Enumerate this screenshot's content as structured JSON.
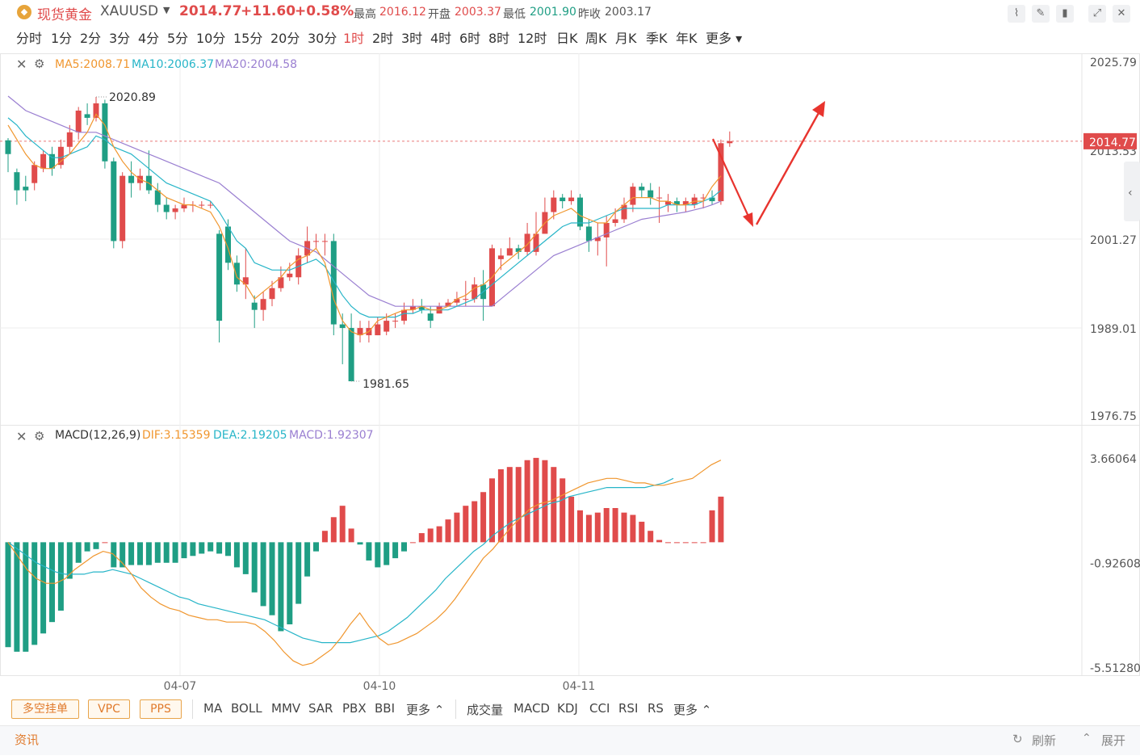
{
  "header": {
    "symbol_name": "现货黄金",
    "symbol_code": "XAUUSD",
    "price": "2014.77",
    "change": "+11.60",
    "change_pct": "+0.58%",
    "high_label": "最高",
    "high": "2016.12",
    "open_label": "开盘",
    "open": "2003.37",
    "low_label": "最低",
    "low": "2001.90",
    "prev_close_label": "昨收",
    "prev_close": "2003.17"
  },
  "periods": [
    "分时",
    "1分",
    "2分",
    "3分",
    "4分",
    "5分",
    "10分",
    "15分",
    "20分",
    "30分",
    "1时",
    "2时",
    "3时",
    "4时",
    "6时",
    "8时",
    "12时",
    "日K",
    "周K",
    "月K",
    "季K",
    "年K",
    "更多"
  ],
  "active_period": "1时",
  "ma_legend": {
    "ma5": "MA5:2008.71",
    "ma10": "MA10:2006.37",
    "ma20": "MA20:2004.58"
  },
  "macd_legend": {
    "name": "MACD(12,26,9)",
    "dif": "DIF:3.15359",
    "dea": "DEA:2.19205",
    "macd": "MACD:1.92307"
  },
  "price_axis": [
    "2025.79",
    "2013.53",
    "2001.27",
    "1989.01",
    "1976.75"
  ],
  "current_price_tag": "2014.77",
  "macd_axis": [
    "3.66064",
    "-0.92608",
    "-5.51280"
  ],
  "high_marker": "2020.89",
  "low_marker": "1981.65",
  "date_labels": [
    "04-07",
    "04-10",
    "04-11"
  ],
  "bottom_buttons": [
    "多空挂单",
    "VPC",
    "PPS"
  ],
  "main_indicators": [
    "MA",
    "BOLL",
    "MMV",
    "SAR",
    "PBX",
    "BBI",
    "更多"
  ],
  "sub_indicators": [
    "成交量",
    "MACD",
    "KDJ",
    "CCI",
    "RSI",
    "RS",
    "更多"
  ],
  "footer": {
    "news": "资讯",
    "refresh": "刷新",
    "expand": "展开"
  },
  "colors": {
    "up": "#e04b4b",
    "down": "#1f9e84",
    "ma5": "#f0962e",
    "ma10": "#27b5c8",
    "ma20": "#9a7fd1",
    "accent": "#e07a2c"
  },
  "chart_data": {
    "type": "candlestick",
    "x_ticks": [
      "04-07",
      "04-10",
      "04-11"
    ],
    "ylim": [
      1976.75,
      2025.79
    ],
    "candles": [
      [
        2014.9,
        2013.0,
        2015.2,
        2010.5
      ],
      [
        2010.5,
        2008.0,
        2011.0,
        2006.0
      ],
      [
        2008.5,
        2008.0,
        2010.0,
        2006.5
      ],
      [
        2009.0,
        2011.5,
        2012.0,
        2008.0
      ],
      [
        2011.0,
        2013.0,
        2013.5,
        2010.5
      ],
      [
        2013.0,
        2011.0,
        2014.0,
        2010.0
      ],
      [
        2011.5,
        2014.0,
        2015.0,
        2011.0
      ],
      [
        2014.0,
        2016.0,
        2017.0,
        2013.0
      ],
      [
        2016.0,
        2019.0,
        2019.5,
        2015.0
      ],
      [
        2018.5,
        2018.0,
        2020.0,
        2017.0
      ],
      [
        2018.0,
        2020.0,
        2020.89,
        2017.5
      ],
      [
        2020.0,
        2012.0,
        2020.5,
        2011.0
      ],
      [
        2012.0,
        2001.0,
        2012.5,
        2000.0
      ],
      [
        2001.0,
        2010.0,
        2010.5,
        2000.0
      ],
      [
        2010.0,
        2009.0,
        2012.0,
        2007.0
      ],
      [
        2009.0,
        2010.0,
        2011.0,
        2008.0
      ],
      [
        2010.0,
        2008.0,
        2013.5,
        2007.5
      ],
      [
        2008.0,
        2006.0,
        2009.0,
        2005.0
      ],
      [
        2006.0,
        2005.0,
        2007.0,
        2004.0
      ],
      [
        2005.0,
        2005.5,
        2006.0,
        2004.0
      ],
      [
        2005.5,
        2006.0,
        2007.0,
        2005.0
      ],
      [
        2006.0,
        2006.0,
        2006.5,
        2005.0
      ],
      [
        2006.0,
        2006.0,
        2006.5,
        2005.5
      ],
      [
        2006.0,
        2006.0,
        2006.5,
        2005.5
      ],
      [
        2002.0,
        1990.0,
        2002.5,
        1987.0
      ],
      [
        2003.0,
        1998.0,
        2004.0,
        1997.0
      ],
      [
        1998.0,
        1995.0,
        1999.0,
        1994.0
      ],
      [
        1995.0,
        1996.0,
        2000.0,
        1993.0
      ],
      [
        1992.5,
        1991.5,
        1993.5,
        1989.0
      ],
      [
        1991.5,
        1993.0,
        1994.0,
        1990.0
      ],
      [
        1993.0,
        1994.5,
        1995.5,
        1992.0
      ],
      [
        1994.5,
        1996.0,
        1997.5,
        1994.0
      ],
      [
        1996.0,
        1996.5,
        1998.0,
        1995.5
      ],
      [
        1996.0,
        1999.0,
        2000.0,
        1995.0
      ],
      [
        1999.0,
        2001.0,
        2003.0,
        1998.0
      ],
      [
        2001.0,
        2001.0,
        2002.0,
        2000.0
      ],
      [
        2001.0,
        2001.0,
        2002.0,
        1999.0
      ],
      [
        2001.0,
        1989.5,
        2002.0,
        1988.0
      ],
      [
        1989.5,
        1989.0,
        1991.0,
        1984.0
      ],
      [
        1989.0,
        1981.65,
        1991.0,
        1981.65
      ],
      [
        1988.0,
        1989.0,
        1990.0,
        1987.0
      ],
      [
        1988.0,
        1989.0,
        1990.0,
        1987.0
      ],
      [
        1988.0,
        1989.5,
        1990.5,
        1988.0
      ],
      [
        1988.5,
        1990.0,
        1991.0,
        1988.0
      ],
      [
        1990.0,
        1990.0,
        1991.0,
        1989.0
      ],
      [
        1990.0,
        1991.5,
        1992.5,
        1989.5
      ],
      [
        1991.5,
        1992.0,
        1993.0,
        1991.0
      ],
      [
        1992.0,
        1991.5,
        1993.0,
        1991.0
      ],
      [
        1991.0,
        1990.0,
        1992.0,
        1989.0
      ],
      [
        1991.0,
        1992.0,
        1992.5,
        1991.0
      ],
      [
        1992.0,
        1992.5,
        1993.0,
        1992.0
      ],
      [
        1992.5,
        1993.0,
        1994.0,
        1992.0
      ],
      [
        1993.0,
        1993.0,
        1995.5,
        1992.0
      ],
      [
        1993.0,
        1995.0,
        1996.0,
        1992.5
      ],
      [
        1995.0,
        1993.0,
        1997.0,
        1990.0
      ],
      [
        1992.0,
        2000.0,
        2000.5,
        1992.0
      ],
      [
        1998.5,
        1999.0,
        2000.0,
        1997.0
      ],
      [
        1999.0,
        2000.0,
        2001.5,
        1999.0
      ],
      [
        2000.0,
        1999.5,
        2000.5,
        1998.5
      ],
      [
        1999.5,
        2002.0,
        2003.5,
        1999.0
      ],
      [
        1999.5,
        2002.0,
        2005.0,
        1999.0
      ],
      [
        2002.0,
        2005.0,
        2007.0,
        2002.0
      ],
      [
        2005.0,
        2007.0,
        2008.0,
        2004.0
      ],
      [
        2007.0,
        2006.5,
        2007.5,
        2005.5
      ],
      [
        2006.5,
        2007.0,
        2008.0,
        2006.0
      ],
      [
        2007.0,
        2003.0,
        2007.5,
        2002.5
      ],
      [
        2003.0,
        2001.0,
        2004.0,
        1999.5
      ],
      [
        2001.0,
        2001.5,
        2003.5,
        1999.0
      ],
      [
        2001.5,
        2003.5,
        2004.5,
        1997.5
      ],
      [
        2003.5,
        2004.0,
        2005.5,
        2003.0
      ],
      [
        2004.0,
        2006.0,
        2007.0,
        2003.5
      ],
      [
        2006.0,
        2008.5,
        2009.0,
        2005.0
      ],
      [
        2008.5,
        2008.0,
        2009.0,
        2007.0
      ],
      [
        2008.0,
        2007.0,
        2009.0,
        2006.0
      ],
      [
        2007.0,
        2007.0,
        2008.5,
        2003.5
      ],
      [
        2006.0,
        2006.5,
        2007.5,
        2005.0
      ],
      [
        2006.5,
        2006.0,
        2007.0,
        2005.0
      ],
      [
        2006.0,
        2006.5,
        2007.0,
        2005.0
      ],
      [
        2006.0,
        2007.0,
        2007.5,
        2005.5
      ],
      [
        2007.0,
        2007.0,
        2007.5,
        2005.5
      ],
      [
        2007.0,
        2006.5,
        2008.0,
        2006.0
      ],
      [
        2006.5,
        2014.5,
        2015.0,
        2006.0
      ],
      [
        2014.5,
        2014.77,
        2016.12,
        2014.0
      ]
    ],
    "ma5": [
      2017.0,
      2015.0,
      2013.0,
      2011.5,
      2011.0,
      2011.0,
      2012.0,
      2013.0,
      2014.5,
      2016.0,
      2018.5,
      2017.0,
      2014.0,
      2012.0,
      2010.5,
      2009.5,
      2009.0,
      2008.0,
      2007.0,
      2006.5,
      2006.0,
      2006.0,
      2005.5,
      2005.0,
      2003.0,
      2000.0,
      1996.0,
      1995.0,
      1993.0,
      1994.0,
      1995.0,
      1996.0,
      1997.5,
      1998.5,
      1999.0,
      2000.0,
      1998.0,
      1993.0,
      1990.0,
      1988.5,
      1988.0,
      1988.5,
      1990.0,
      1990.5,
      1991.0,
      1991.5,
      1991.5,
      1992.0,
      1991.5,
      1991.5,
      1992.0,
      1993.0,
      1993.5,
      1994.5,
      1995.0,
      1996.0,
      1997.5,
      1998.5,
      1999.5,
      2000.5,
      2002.0,
      2003.5,
      2004.5,
      2005.0,
      2005.5,
      2004.5,
      2004.0,
      2003.5,
      2003.5,
      2005.0,
      2006.0,
      2007.0,
      2007.0,
      2007.0,
      2006.5,
      2006.5,
      2006.0,
      2006.0,
      2006.5,
      2006.5,
      2008.5,
      2010.0
    ],
    "ma10": [
      2018.0,
      2017.0,
      2015.5,
      2014.5,
      2013.5,
      2012.5,
      2012.5,
      2013.0,
      2013.5,
      2014.0,
      2015.5,
      2015.0,
      2014.0,
      2013.5,
      2013.0,
      2012.0,
      2011.0,
      2010.0,
      2009.0,
      2008.5,
      2008.0,
      2007.5,
      2007.0,
      2006.5,
      2005.0,
      2003.0,
      2001.0,
      2000.0,
      1998.0,
      1997.5,
      1997.0,
      1997.0,
      1997.0,
      1997.5,
      1998.0,
      1998.5,
      1997.5,
      1995.5,
      1993.5,
      1992.0,
      1991.0,
      1990.5,
      1990.5,
      1990.5,
      1990.5,
      1991.0,
      1991.0,
      1991.5,
      1991.5,
      1991.5,
      1991.5,
      1992.0,
      1992.5,
      1993.0,
      1994.0,
      1995.0,
      1996.0,
      1997.0,
      1998.0,
      1999.0,
      2000.0,
      2001.0,
      2002.0,
      2003.0,
      2003.5,
      2003.5,
      2003.5,
      2004.0,
      2004.5,
      2005.0,
      2005.5,
      2005.5,
      2005.5,
      2005.5,
      2005.5,
      2006.0,
      2006.0,
      2006.0,
      2006.0,
      2006.5,
      2007.0,
      2008.0
    ],
    "ma20": [
      2021.0,
      2020.0,
      2019.0,
      2018.5,
      2018.0,
      2017.5,
      2017.0,
      2016.5,
      2016.0,
      2016.0,
      2016.0,
      2015.5,
      2015.0,
      2014.5,
      2014.0,
      2013.5,
      2013.0,
      2012.5,
      2012.0,
      2011.5,
      2011.0,
      2010.5,
      2010.0,
      2009.5,
      2009.0,
      2008.0,
      2007.0,
      2006.0,
      2005.0,
      2004.0,
      2003.0,
      2002.0,
      2001.0,
      2000.5,
      2000.0,
      1999.5,
      1998.5,
      1997.5,
      1996.5,
      1995.5,
      1994.5,
      1993.5,
      1993.0,
      1992.5,
      1992.0,
      1992.0,
      1992.0,
      1992.0,
      1992.0,
      1992.0,
      1992.0,
      1992.0,
      1992.0,
      1992.0,
      1992.0,
      1992.0,
      1993.0,
      1994.0,
      1995.0,
      1996.0,
      1997.0,
      1998.0,
      1999.0,
      1999.5,
      2000.0,
      2000.5,
      2001.0,
      2001.5,
      2002.0,
      2002.5,
      2003.0,
      2003.5,
      2004.0,
      2004.2,
      2004.4,
      2004.6,
      2004.8,
      2005.0,
      2005.3,
      2005.6,
      2006.0,
      2006.5
    ],
    "macd_ylim": [
      -5.5128,
      3.66064
    ],
    "macd_hist": [
      -4.6,
      -4.8,
      -4.8,
      -4.5,
      -4.0,
      -3.5,
      -3.0,
      -1.6,
      -0.9,
      -0.4,
      -0.3,
      0.0,
      -1.1,
      -1.1,
      -1.0,
      -1.0,
      -1.0,
      -0.9,
      -0.9,
      -0.9,
      -0.7,
      -0.6,
      -0.5,
      -0.4,
      -0.5,
      -0.6,
      -1.1,
      -1.4,
      -2.2,
      -2.8,
      -3.2,
      -3.9,
      -3.6,
      -2.7,
      -1.5,
      -0.4,
      0.5,
      1.1,
      1.6,
      0.6,
      -0.1,
      -0.8,
      -1.1,
      -1.0,
      -0.7,
      -0.4,
      0.0,
      0.4,
      0.6,
      0.7,
      1.0,
      1.3,
      1.6,
      1.8,
      2.2,
      2.8,
      3.2,
      3.3,
      3.3,
      3.6,
      3.7,
      3.6,
      3.3,
      2.8,
      2.0,
      1.4,
      1.2,
      1.3,
      1.5,
      1.5,
      1.3,
      1.2,
      0.9,
      0.5,
      0.1,
      0.0,
      0.0,
      0.0,
      0.0,
      0.0,
      1.4,
      2.0
    ],
    "macd_dif": [
      0.0,
      -0.6,
      -1.2,
      -1.6,
      -1.8,
      -1.8,
      -1.6,
      -1.2,
      -0.9,
      -0.6,
      -0.4,
      -0.5,
      -0.9,
      -1.4,
      -2.0,
      -2.4,
      -2.7,
      -2.9,
      -3.0,
      -3.2,
      -3.3,
      -3.4,
      -3.4,
      -3.5,
      -3.5,
      -3.5,
      -3.6,
      -3.9,
      -4.3,
      -4.8,
      -5.2,
      -5.4,
      -5.3,
      -5.0,
      -4.7,
      -4.2,
      -3.6,
      -3.1,
      -3.7,
      -4.2,
      -4.5,
      -4.4,
      -4.2,
      -4.0,
      -3.7,
      -3.4,
      -3.0,
      -2.5,
      -1.9,
      -1.3,
      -0.7,
      -0.3,
      0.2,
      0.7,
      1.1,
      1.5,
      1.7,
      1.8,
      2.0,
      2.2,
      2.4,
      2.6,
      2.7,
      2.8,
      2.8,
      2.7,
      2.6,
      2.6,
      2.5,
      2.5,
      2.6,
      2.7,
      2.8,
      3.1,
      3.4,
      3.6
    ],
    "macd_dea": [
      0.0,
      -0.3,
      -0.6,
      -0.9,
      -1.1,
      -1.3,
      -1.4,
      -1.4,
      -1.4,
      -1.3,
      -1.3,
      -1.2,
      -1.3,
      -1.4,
      -1.6,
      -1.8,
      -2.0,
      -2.2,
      -2.4,
      -2.5,
      -2.7,
      -2.8,
      -2.9,
      -3.0,
      -3.1,
      -3.2,
      -3.3,
      -3.4,
      -3.6,
      -3.8,
      -4.0,
      -4.2,
      -4.3,
      -4.4,
      -4.4,
      -4.4,
      -4.4,
      -4.3,
      -4.2,
      -4.1,
      -3.9,
      -3.6,
      -3.3,
      -2.9,
      -2.5,
      -2.1,
      -1.6,
      -1.2,
      -0.8,
      -0.4,
      -0.1,
      0.3,
      0.6,
      0.9,
      1.1,
      1.3,
      1.5,
      1.7,
      1.8,
      2.0,
      2.1,
      2.2,
      2.3,
      2.4,
      2.4,
      2.4,
      2.4,
      2.4,
      2.5,
      2.6,
      2.8
    ]
  }
}
